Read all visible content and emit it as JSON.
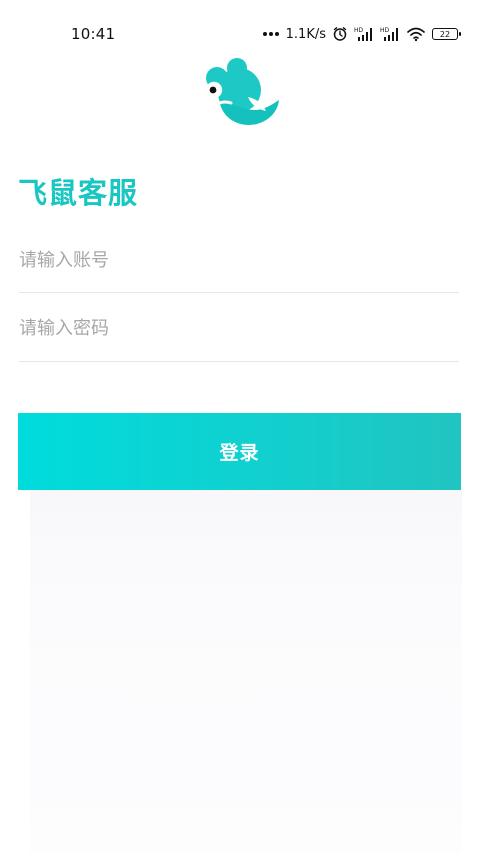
{
  "status_bar": {
    "time": "10:41",
    "network_speed": "1.1K/s",
    "battery_level": "22",
    "icons": [
      "more-dots-icon",
      "alarm-clock-icon",
      "hd-signal-icon",
      "hd-signal-icon",
      "wifi-icon",
      "battery-icon"
    ]
  },
  "app": {
    "title": "飞鼠客服",
    "brand_color": "#18c6c2",
    "logo_icon": "flying-mouse-logo-icon"
  },
  "login": {
    "account_placeholder": "请输入账号",
    "account_value": "",
    "password_placeholder": "请输入密码",
    "password_value": "",
    "submit_label": "登录",
    "button_gradient": [
      "#00dcdc",
      "#21c4c0"
    ]
  }
}
